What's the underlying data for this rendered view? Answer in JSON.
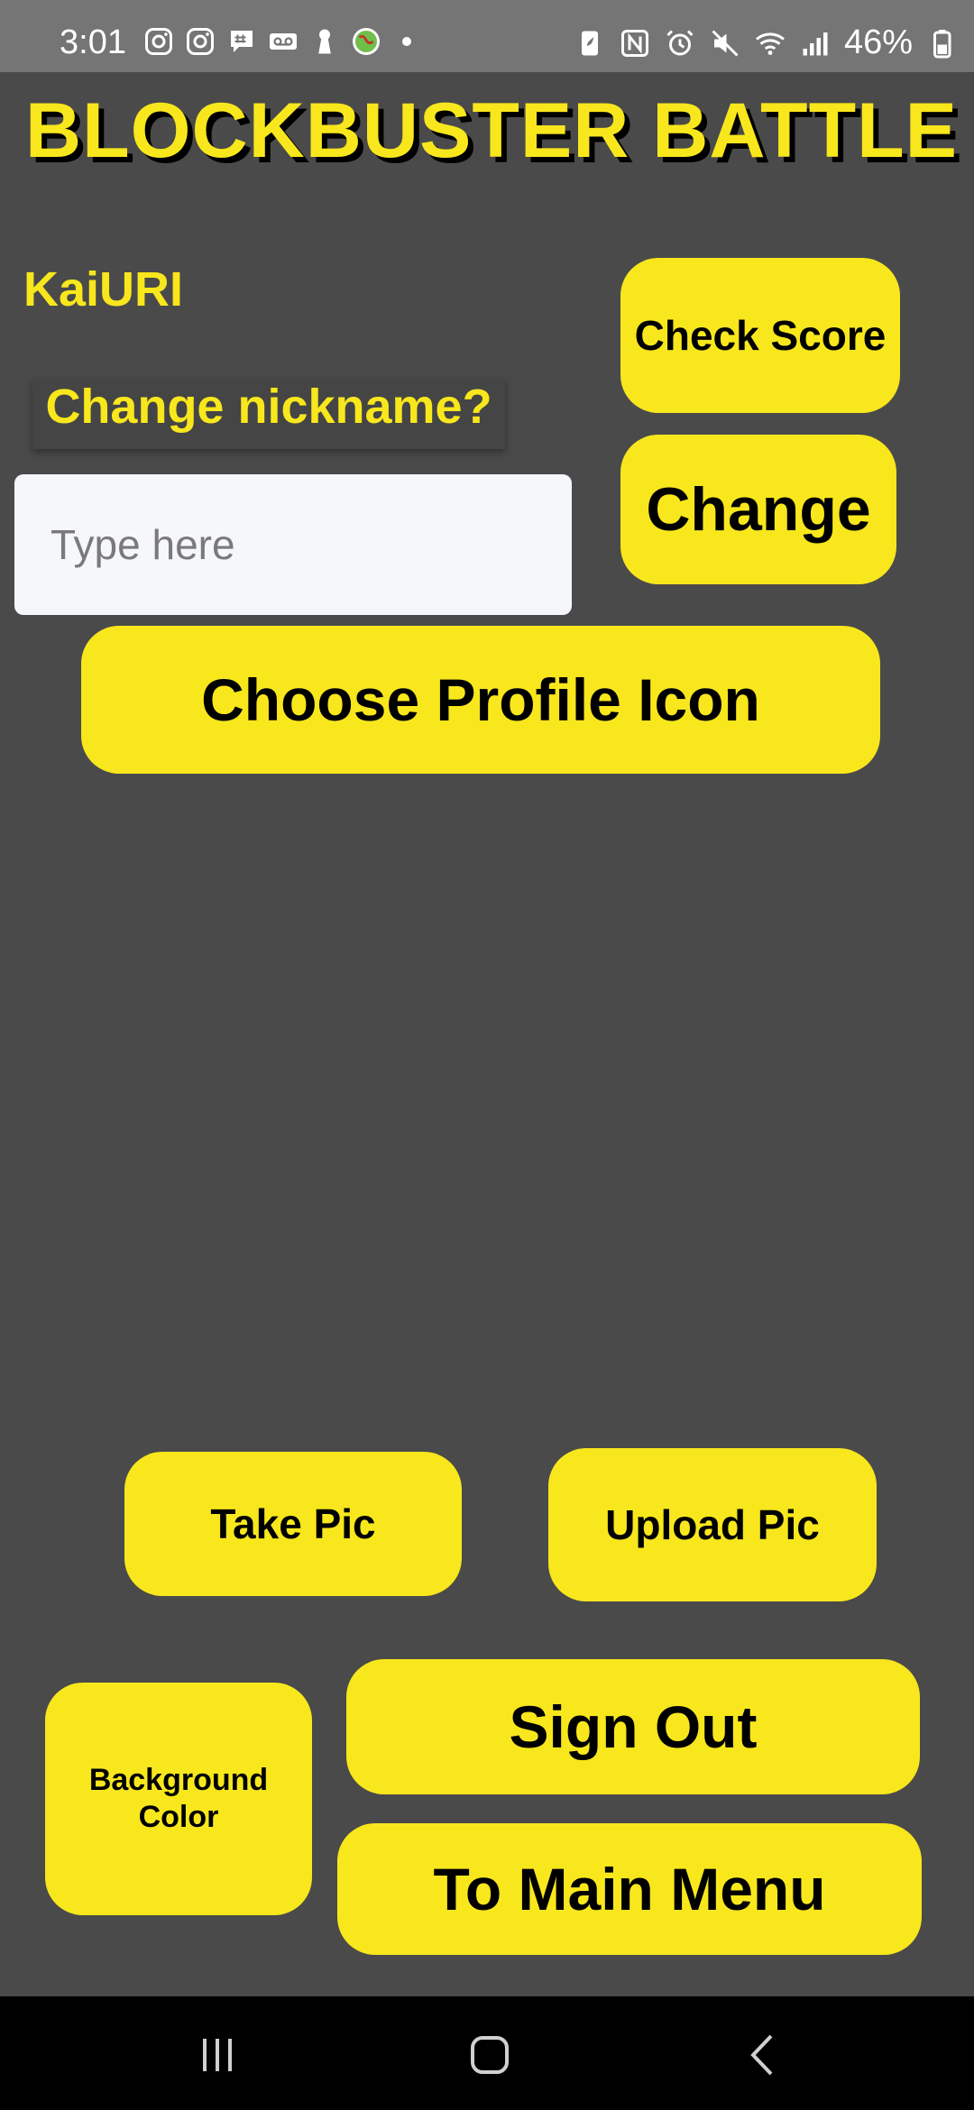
{
  "status_bar": {
    "time": "3:01",
    "battery": "46%",
    "left_icons": [
      "instagram-icon",
      "instagram-icon",
      "chat-icon",
      "voicemail-icon",
      "keyhole-icon",
      "globe-icon"
    ],
    "right_icons": [
      "battery-saver-icon",
      "nfc-icon",
      "alarm-icon",
      "mute-icon",
      "wifi-icon",
      "signal-icon",
      "battery-icon"
    ]
  },
  "app": {
    "title": "BLOCKBUSTER BATTLE",
    "nickname": "KaiURI",
    "change_nickname_label": "Change nickname?",
    "nickname_input": {
      "value": "",
      "placeholder": "Type here"
    }
  },
  "buttons": {
    "check_score": "Check Score",
    "change": "Change",
    "choose_profile_icon": "Choose Profile Icon",
    "take_pic": "Take Pic",
    "upload_pic": "Upload Pic",
    "background_color": "Background Color",
    "sign_out": "Sign Out",
    "to_main_menu": "To Main Menu"
  },
  "nav_bar": {
    "items": [
      "recent-apps-icon",
      "home-icon",
      "back-icon"
    ]
  },
  "colors": {
    "background": "#4a4a4a",
    "accent": "#f8e71c",
    "status_bar": "#757575",
    "nav_bar": "#000000"
  }
}
